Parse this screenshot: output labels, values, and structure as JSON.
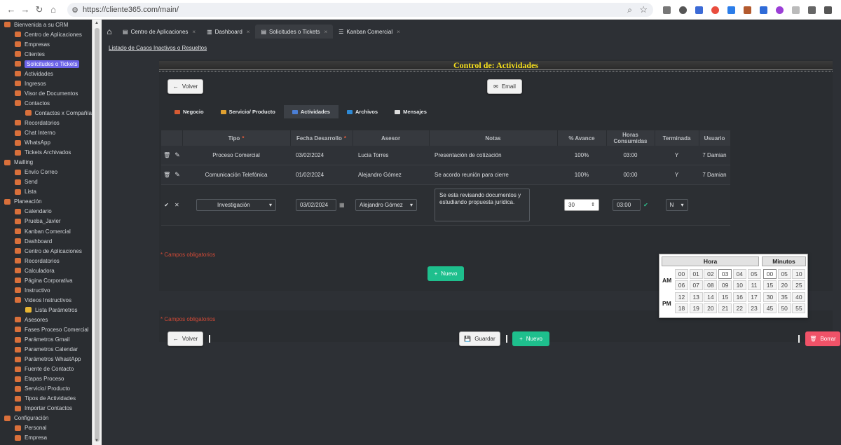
{
  "browser": {
    "url": "https://cliente365.com/main/",
    "nav": [
      "←",
      "→",
      "↻",
      "⌂"
    ]
  },
  "sidebar": {
    "items": [
      {
        "label": "Bienvenida a su CRM",
        "lvl": 0,
        "icon": "globe-icon"
      },
      {
        "label": "Centro de Aplicaciones",
        "lvl": 1,
        "icon": "apps-icon"
      },
      {
        "label": "Empresas",
        "lvl": 1,
        "icon": "building-icon"
      },
      {
        "label": "Clientes",
        "lvl": 1,
        "icon": "users-icon"
      },
      {
        "label": "Solicitudes o Tickets",
        "lvl": 1,
        "icon": "ticket-icon",
        "active": true
      },
      {
        "label": "Actividades",
        "lvl": 1,
        "icon": "activity-icon"
      },
      {
        "label": "Ingresos",
        "lvl": 1,
        "icon": "dollar-icon"
      },
      {
        "label": "Visor de Documentos",
        "lvl": 1,
        "icon": "document-icon"
      },
      {
        "label": "Contactos",
        "lvl": 1,
        "icon": "contacts-icon"
      },
      {
        "label": "Contactos x Compañía",
        "lvl": 2,
        "icon": "contacts-icon"
      },
      {
        "label": "Recordatorios",
        "lvl": 1,
        "icon": "bell-icon"
      },
      {
        "label": "Chat Interno",
        "lvl": 1,
        "icon": "chat-icon"
      },
      {
        "label": "WhatsApp",
        "lvl": 1,
        "icon": "whatsapp-icon"
      },
      {
        "label": "Tickets Archivados",
        "lvl": 1,
        "icon": "archive-icon"
      },
      {
        "label": "Mailling",
        "lvl": 0,
        "icon": "mail-icon"
      },
      {
        "label": "Envío Correo",
        "lvl": 1,
        "icon": "send-icon"
      },
      {
        "label": "Send",
        "lvl": 1,
        "icon": "send-icon"
      },
      {
        "label": "Lista",
        "lvl": 1,
        "icon": "list-icon"
      },
      {
        "label": "Planeación",
        "lvl": 0,
        "icon": "chart-icon"
      },
      {
        "label": "Calendario",
        "lvl": 1,
        "icon": "calendar-icon"
      },
      {
        "label": "Prueba_Javier",
        "lvl": 1,
        "icon": "test-icon"
      },
      {
        "label": "Kanban Comercial",
        "lvl": 1,
        "icon": "kanban-icon"
      },
      {
        "label": "Dashboard",
        "lvl": 1,
        "icon": "dashboard-icon"
      },
      {
        "label": "Centro de Aplicaciones",
        "lvl": 1,
        "icon": "apps-icon"
      },
      {
        "label": "Recordatorios",
        "lvl": 1,
        "icon": "bell-icon"
      },
      {
        "label": "Calculadora",
        "lvl": 1,
        "icon": "calculator-icon"
      },
      {
        "label": "Página Corporativa",
        "lvl": 1,
        "icon": "web-icon"
      },
      {
        "label": "Instructivo",
        "lvl": 1,
        "icon": "book-icon"
      },
      {
        "label": "Videos Instructivos",
        "lvl": 1,
        "icon": "video-icon"
      },
      {
        "label": "Lista Parámetros",
        "lvl": 2,
        "icon": "checkbox-icon"
      },
      {
        "label": "Asesores",
        "lvl": 1,
        "icon": "users-icon"
      },
      {
        "label": "Fases Proceso Comercial",
        "lvl": 1,
        "icon": "phases-icon"
      },
      {
        "label": "Parámetros Gmail",
        "lvl": 1,
        "icon": "gmail-icon"
      },
      {
        "label": "Parametros Calendar",
        "lvl": 1,
        "icon": "calendar-icon"
      },
      {
        "label": "Parámetros WhastApp",
        "lvl": 1,
        "icon": "whatsapp-icon"
      },
      {
        "label": "Fuente de Contacto",
        "lvl": 1,
        "icon": "source-icon"
      },
      {
        "label": "Etapas Proceso",
        "lvl": 1,
        "icon": "stages-icon"
      },
      {
        "label": "Servicio/ Producto",
        "lvl": 1,
        "icon": "product-icon"
      },
      {
        "label": "Tipos de Actividades",
        "lvl": 1,
        "icon": "types-icon"
      },
      {
        "label": "Importar Contactos",
        "lvl": 1,
        "icon": "import-icon"
      },
      {
        "label": "Configuración",
        "lvl": 0,
        "icon": "gear-icon"
      },
      {
        "label": "Personal",
        "lvl": 1,
        "icon": "person-icon"
      },
      {
        "label": "Empresa",
        "lvl": 1,
        "icon": "building-icon"
      }
    ]
  },
  "tabs": [
    {
      "label": "Centro de Aplicaciones",
      "icon": "▤"
    },
    {
      "label": "Dashboard",
      "icon": "▥"
    },
    {
      "label": "Solicitudes o Tickets",
      "icon": "▤",
      "active": true
    },
    {
      "label": "Kanban Comercial",
      "icon": "☰"
    }
  ],
  "tab_close": "×",
  "breadcrumb": "Listado de Casos Inactivos o Resueltos",
  "panel_title": "Control de: Actividades",
  "buttons": {
    "volver": "Volver",
    "email": "Email",
    "nuevo": "Nuevo",
    "guardar": "Guardar",
    "borrar": "Borrar",
    "volver_icon": "←",
    "email_icon": "✉",
    "nuevo_icon": "+",
    "guardar_icon": "💾",
    "borrar_icon": "🗑"
  },
  "subtabs": [
    "Negocio",
    "Servicio/ Producto",
    "Actividades",
    "Archivos",
    "Mensajes"
  ],
  "columns": [
    "Tipo",
    "Fecha Desarrollo",
    "Asesor",
    "Notas",
    "% Avance",
    "Horas Consumidas",
    "Terminada",
    "Usuario"
  ],
  "required_mark": "*",
  "rows": [
    {
      "tipo": "Proceso Comercial",
      "fecha": "03/02/2024",
      "asesor": "Lucia Torres",
      "notas": "Presentación de cotización",
      "avance": "100%",
      "horas": "03:00",
      "terminada": "Y",
      "usuario": "7 Damian"
    },
    {
      "tipo": "Comunicación Telefónica",
      "fecha": "01/02/2024",
      "asesor": "Alejandro Gómez",
      "notas": "Se acordo reunión para cierre",
      "avance": "100%",
      "horas": "00:00",
      "terminada": "Y",
      "usuario": "7 Damian"
    }
  ],
  "edit": {
    "tipo": "Investigación",
    "fecha": "03/02/2024",
    "asesor": "Alejandro Gómez",
    "notas": "Se esta revisando documentos y estudiando propuesta jurídica.",
    "avance": "30",
    "horas": "03:00",
    "terminada": "N"
  },
  "required_note": "* Campos obligatorios",
  "timepicker": {
    "hora_label": "Hora",
    "minutos_label": "Minutos",
    "am": "AM",
    "pm": "PM",
    "am_hours": [
      "00",
      "01",
      "02",
      "03",
      "04",
      "05",
      "06",
      "07",
      "08",
      "09",
      "10",
      "11"
    ],
    "pm_hours": [
      "12",
      "13",
      "14",
      "15",
      "16",
      "17",
      "18",
      "19",
      "20",
      "21",
      "22",
      "23"
    ],
    "minutes": [
      "00",
      "05",
      "10",
      "15",
      "20",
      "25",
      "30",
      "35",
      "40",
      "45",
      "50",
      "55"
    ],
    "selected_hour": "03",
    "selected_minute": "00"
  }
}
